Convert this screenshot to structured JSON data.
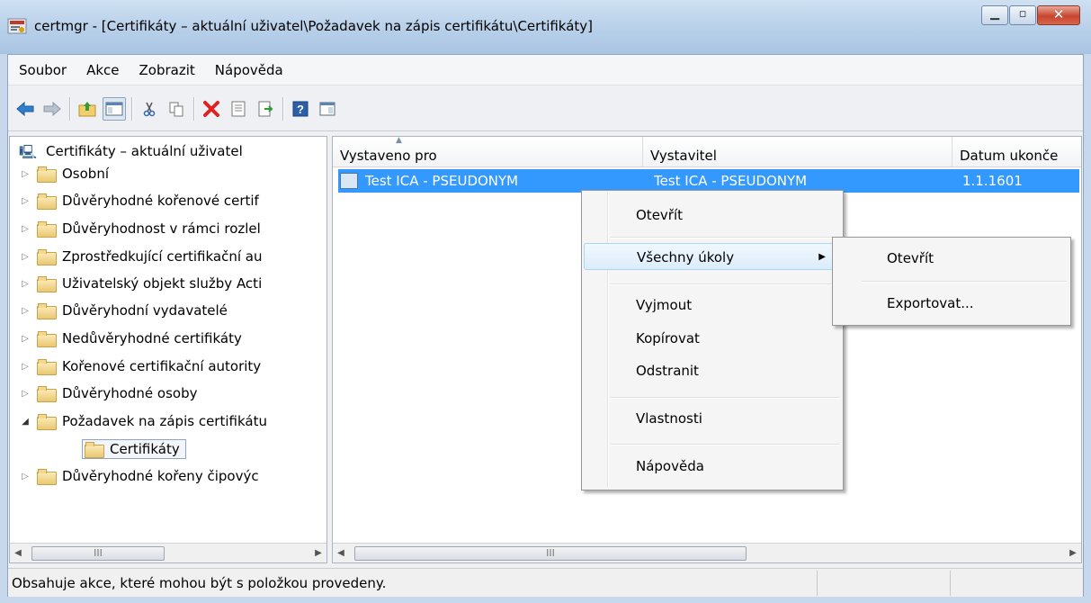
{
  "window": {
    "title": "certmgr - [Certifikáty – aktuální uživatel\\Požadavek na zápis certifikátu\\Certifikáty]"
  },
  "menubar": [
    "Soubor",
    "Akce",
    "Zobrazit",
    "Nápověda"
  ],
  "tree": {
    "root": "Certifikáty – aktuální uživatel",
    "items": [
      {
        "label": "Osobní",
        "expander": "▷"
      },
      {
        "label": "Důvěryhodné kořenové certif",
        "expander": "▷"
      },
      {
        "label": "Důvěryhodnost v rámci rozlel",
        "expander": "▷"
      },
      {
        "label": "Zprostředkující certifikační au",
        "expander": "▷"
      },
      {
        "label": "Uživatelský objekt služby Acti",
        "expander": "▷"
      },
      {
        "label": "Důvěryhodní vydavatelé",
        "expander": "▷"
      },
      {
        "label": "Nedůvěryhodné certifikáty",
        "expander": "▷"
      },
      {
        "label": "Kořenové certifikační autority",
        "expander": "▷"
      },
      {
        "label": "Důvěryhodné osoby",
        "expander": "▷"
      },
      {
        "label": "Požadavek na zápis certifikátu",
        "expander": "◢"
      },
      {
        "label": "Certifikáty",
        "expander": ""
      },
      {
        "label": "Důvěryhodné kořeny čipovýc",
        "expander": "▷"
      }
    ]
  },
  "list": {
    "columns": [
      "Vystaveno pro",
      "Vystavitel",
      "Datum ukonče"
    ],
    "rows": [
      {
        "issued_to": "Test ICA - PSEUDONYM",
        "issuer": "Test ICA - PSEUDONYM",
        "expiry": "1.1.1601"
      }
    ]
  },
  "context_menu": {
    "items": [
      "Otevřít",
      "Všechny úkoly",
      "Vyjmout",
      "Kopírovat",
      "Odstranit",
      "Vlastnosti",
      "Nápověda"
    ],
    "submenu_arrow": "▶"
  },
  "submenu": {
    "items": [
      "Otevřít",
      "Exportovat..."
    ]
  },
  "scroll": {
    "left_arrow": "◀",
    "right_arrow": "▶",
    "grip": "III"
  },
  "status": {
    "text": "Obsahuje akce, které mohou být s položkou provedeny."
  },
  "colors": {
    "selection": "#3399ff",
    "title_gradient_top": "#cfe0f1",
    "close_button": "#c7452e"
  },
  "icons": [
    "back-arrow-icon",
    "forward-arrow-icon",
    "up-folder-icon",
    "show-hide-tree-icon",
    "cut-icon",
    "copy-icon",
    "delete-icon",
    "properties-icon",
    "export-icon",
    "help-icon",
    "view-icon"
  ]
}
